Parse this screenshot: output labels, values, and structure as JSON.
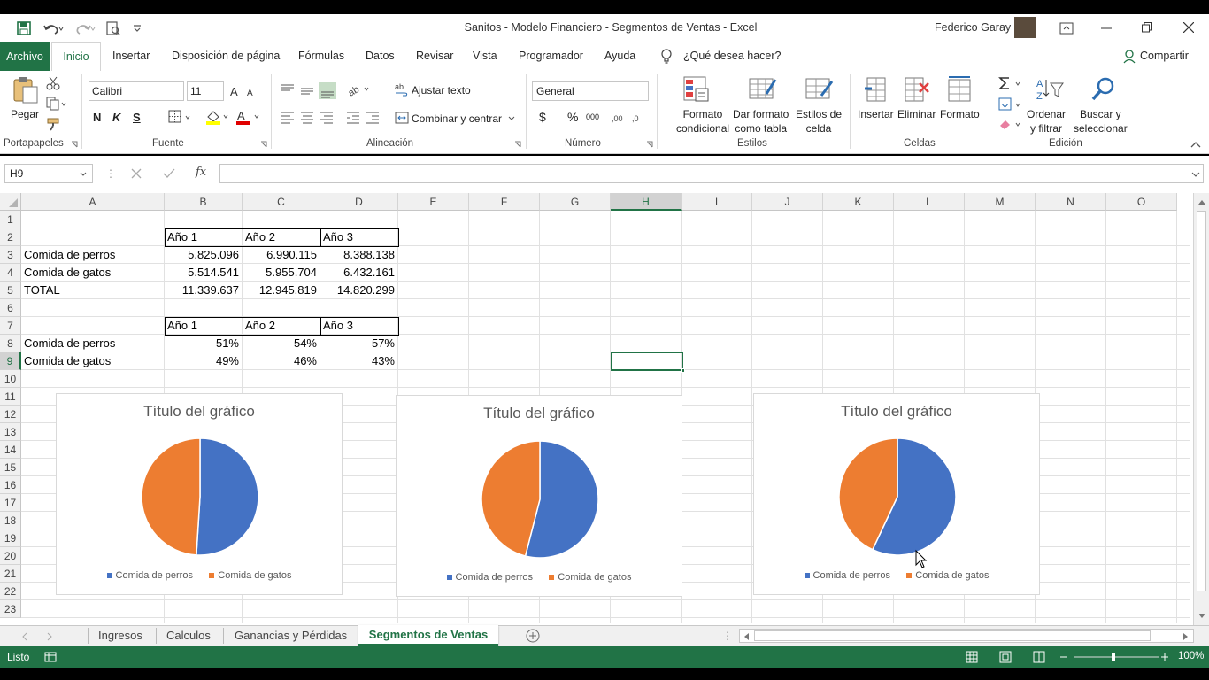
{
  "window": {
    "title": "Sanitos - Modelo Financiero - Segmentos de Ventas  -  Excel",
    "user": "Federico Garay"
  },
  "menu": {
    "tabs": [
      "Archivo",
      "Inicio",
      "Insertar",
      "Disposición de página",
      "Fórmulas",
      "Datos",
      "Revisar",
      "Vista",
      "Programador",
      "Ayuda"
    ],
    "tell_me": "¿Qué desea hacer?",
    "share": "Compartir"
  },
  "ribbon": {
    "portapapeles": {
      "label": "Portapapeles",
      "paste": "Pegar"
    },
    "fuente": {
      "label": "Fuente",
      "font": "Calibri",
      "size": "11",
      "bold": "N",
      "italic": "K",
      "underline": "S"
    },
    "alineacion": {
      "label": "Alineación",
      "wrap": "Ajustar texto",
      "merge": "Combinar y centrar"
    },
    "numero": {
      "label": "Número",
      "format": "General",
      "currency": "$",
      "percent": "%",
      "thousands": "000"
    },
    "estilos": {
      "label": "Estilos",
      "cond_1": "Formato",
      "cond_2": "condicional",
      "table_1": "Dar formato",
      "table_2": "como tabla",
      "cell_1": "Estilos de",
      "cell_2": "celda"
    },
    "celdas": {
      "label": "Celdas",
      "insert": "Insertar",
      "delete": "Eliminar",
      "format": "Formato"
    },
    "edicion": {
      "label": "Edición",
      "sort_1": "Ordenar",
      "sort_2": "y filtrar",
      "find_1": "Buscar y",
      "find_2": "seleccionar"
    }
  },
  "formula_bar": {
    "name_box": "H9",
    "fx": "fx",
    "value": ""
  },
  "columns": [
    "A",
    "B",
    "C",
    "D",
    "E",
    "F",
    "G",
    "H",
    "I",
    "J",
    "K",
    "L",
    "M",
    "N",
    "O"
  ],
  "rows": [
    "1",
    "2",
    "3",
    "4",
    "5",
    "6",
    "7",
    "8",
    "9",
    "10",
    "11",
    "12",
    "13",
    "14",
    "15",
    "16",
    "17",
    "18",
    "19",
    "20",
    "21",
    "22",
    "23"
  ],
  "table1": {
    "headers": [
      "Año 1",
      "Año 2",
      "Año 3"
    ],
    "rows": [
      {
        "label": "Comida de perros",
        "values": [
          "5.825.096",
          "6.990.115",
          "8.388.138"
        ]
      },
      {
        "label": "Comida de gatos",
        "values": [
          "5.514.541",
          "5.955.704",
          "6.432.161"
        ]
      },
      {
        "label": "TOTAL",
        "values": [
          "11.339.637",
          "12.945.819",
          "14.820.299"
        ]
      }
    ]
  },
  "table2": {
    "headers": [
      "Año 1",
      "Año 2",
      "Año 3"
    ],
    "rows": [
      {
        "label": "Comida de perros",
        "values": [
          "51%",
          "54%",
          "57%"
        ]
      },
      {
        "label": "Comida de gatos",
        "values": [
          "49%",
          "46%",
          "43%"
        ]
      }
    ]
  },
  "chart_data": [
    {
      "type": "pie",
      "title": "Título del gráfico",
      "categories": [
        "Comida de perros",
        "Comida de gatos"
      ],
      "values": [
        51,
        49
      ],
      "colors": [
        "#4472c4",
        "#ed7d31"
      ],
      "legend": "bottom"
    },
    {
      "type": "pie",
      "title": "Título del gráfico",
      "categories": [
        "Comida de perros",
        "Comida de gatos"
      ],
      "values": [
        54,
        46
      ],
      "colors": [
        "#4472c4",
        "#ed7d31"
      ],
      "legend": "bottom"
    },
    {
      "type": "pie",
      "title": "Título del gráfico",
      "categories": [
        "Comida de perros",
        "Comida de gatos"
      ],
      "values": [
        57,
        43
      ],
      "colors": [
        "#4472c4",
        "#ed7d31"
      ],
      "legend": "bottom"
    }
  ],
  "sheet_tabs": [
    "Ingresos",
    "Calculos",
    "Ganancias y Pérdidas",
    "Segmentos de Ventas"
  ],
  "active_sheet": "Segmentos de Ventas",
  "status": {
    "mode": "Listo",
    "zoom": "100%"
  },
  "colors": {
    "excel_green": "#217346",
    "selection": "#217346"
  }
}
